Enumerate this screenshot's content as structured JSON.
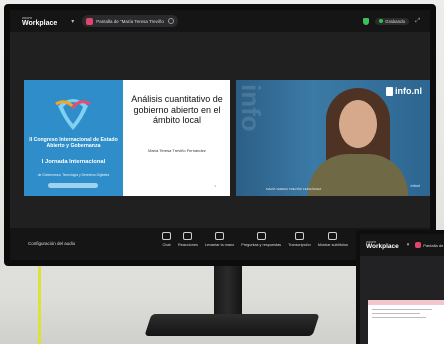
{
  "zoom": {
    "brand_small": "zoom",
    "brand_big": "Workplace",
    "share_label": "Pantalla de \"María Teresa Treviño",
    "recording_label": "Grabando"
  },
  "slide": {
    "title": "Análisis cuantitativo de gobierno abierto en el ámbito local",
    "author": "María Teresa Treviño Fernández",
    "congress_line": "II Congreso Internacional de Estado Abierto y Gobernanza",
    "jornada_line": "I Jornada Internacional",
    "jornada_sub": "de Gobernanza, Tecnología y Derechos Digitales",
    "page_number": "1"
  },
  "video": {
    "watermark_text": "info",
    "logo_text": "info.nl",
    "name_tag": "MARÍA TERESA TREVIÑO FERNÁNDEZ",
    "corner_tag": "infonl"
  },
  "toolbar": {
    "audio_config": "Configuración del audio",
    "tools": [
      {
        "label": "Chat"
      },
      {
        "label": "Reacciones"
      },
      {
        "label": "Levantar la mano"
      },
      {
        "label": "Preguntas y respuestas"
      },
      {
        "label": "Transcripción"
      },
      {
        "label": "Mostrar subtítulos"
      }
    ]
  },
  "second_monitor": {
    "brand_small": "zoom",
    "brand_big": "Workplace",
    "share_label": "Pantalla de"
  },
  "colors": {
    "slide_blue": "#2f8ec9",
    "video_blue": "#3b7aa6",
    "cable_yellow": "#d9e33a",
    "share_pink": "#e0456e"
  }
}
